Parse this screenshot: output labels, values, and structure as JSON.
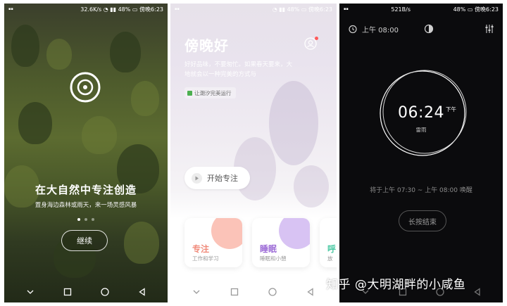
{
  "screen1": {
    "status": {
      "speed": "32.6K/s",
      "battery": "48%",
      "time": "傍晚6:23"
    },
    "logo_icon": "target-icon",
    "title": "在大自然中专注创造",
    "subtitle": "置身海边森林或雨天，来一场灵感风暴",
    "page_dots": 3,
    "active_dot": 0,
    "continue_label": "继续"
  },
  "screen2": {
    "status": {
      "battery": "48%",
      "time": "傍晚6:23"
    },
    "greeting": "傍晚好",
    "quote": "好好品味，不要匆忙。如果春天要来，大地就会以一种完美的方式与",
    "tag_label": "让潮汐完美运行",
    "start_label": "开始专注",
    "cards": [
      {
        "title": "专注",
        "sub": "工作和学习",
        "title_color": "#f08a7a",
        "blob": "#fbc3b8"
      },
      {
        "title": "睡眠",
        "sub": "睡眠和小憩",
        "title_color": "#9b6ad6",
        "blob": "#d8c3f3"
      },
      {
        "title": "呼",
        "sub": "放",
        "title_color": "#4cc9a4",
        "blob": "#c8f0e2"
      }
    ]
  },
  "screen3": {
    "status": {
      "speed": "521B/s",
      "battery": "48%",
      "time": "傍晚6:23"
    },
    "alarm_label": "上午 08:00",
    "time": "06:24",
    "ampm": "下午",
    "weather": "雷雨",
    "note": "将于上午 07:30 ~ 上午 08:00 唤醒",
    "end_label": "长按结束"
  },
  "watermark": "知乎 @大明湖畔的小咸鱼",
  "colors": {
    "accent_focus": "#f08a7a",
    "accent_sleep": "#9b6ad6"
  }
}
